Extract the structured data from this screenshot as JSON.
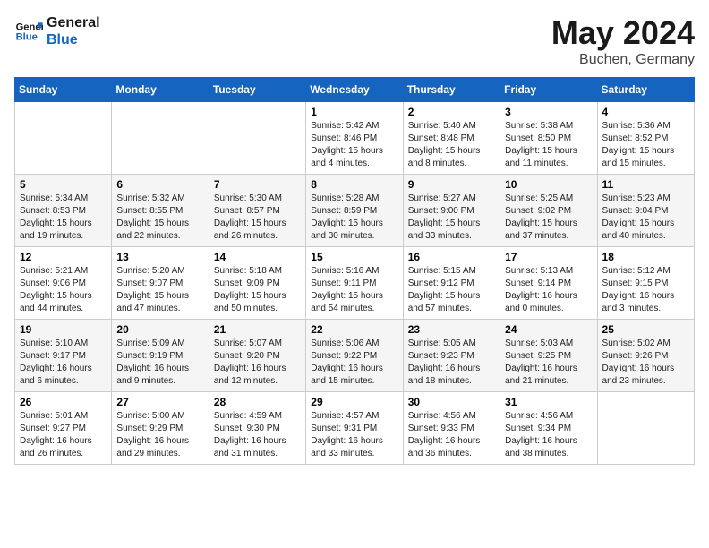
{
  "header": {
    "logo_line1": "General",
    "logo_line2": "Blue",
    "month_title": "May 2024",
    "location": "Buchen, Germany"
  },
  "weekdays": [
    "Sunday",
    "Monday",
    "Tuesday",
    "Wednesday",
    "Thursday",
    "Friday",
    "Saturday"
  ],
  "weeks": [
    [
      {
        "day": "",
        "info": ""
      },
      {
        "day": "",
        "info": ""
      },
      {
        "day": "",
        "info": ""
      },
      {
        "day": "1",
        "info": "Sunrise: 5:42 AM\nSunset: 8:46 PM\nDaylight: 15 hours\nand 4 minutes."
      },
      {
        "day": "2",
        "info": "Sunrise: 5:40 AM\nSunset: 8:48 PM\nDaylight: 15 hours\nand 8 minutes."
      },
      {
        "day": "3",
        "info": "Sunrise: 5:38 AM\nSunset: 8:50 PM\nDaylight: 15 hours\nand 11 minutes."
      },
      {
        "day": "4",
        "info": "Sunrise: 5:36 AM\nSunset: 8:52 PM\nDaylight: 15 hours\nand 15 minutes."
      }
    ],
    [
      {
        "day": "5",
        "info": "Sunrise: 5:34 AM\nSunset: 8:53 PM\nDaylight: 15 hours\nand 19 minutes."
      },
      {
        "day": "6",
        "info": "Sunrise: 5:32 AM\nSunset: 8:55 PM\nDaylight: 15 hours\nand 22 minutes."
      },
      {
        "day": "7",
        "info": "Sunrise: 5:30 AM\nSunset: 8:57 PM\nDaylight: 15 hours\nand 26 minutes."
      },
      {
        "day": "8",
        "info": "Sunrise: 5:28 AM\nSunset: 8:59 PM\nDaylight: 15 hours\nand 30 minutes."
      },
      {
        "day": "9",
        "info": "Sunrise: 5:27 AM\nSunset: 9:00 PM\nDaylight: 15 hours\nand 33 minutes."
      },
      {
        "day": "10",
        "info": "Sunrise: 5:25 AM\nSunset: 9:02 PM\nDaylight: 15 hours\nand 37 minutes."
      },
      {
        "day": "11",
        "info": "Sunrise: 5:23 AM\nSunset: 9:04 PM\nDaylight: 15 hours\nand 40 minutes."
      }
    ],
    [
      {
        "day": "12",
        "info": "Sunrise: 5:21 AM\nSunset: 9:06 PM\nDaylight: 15 hours\nand 44 minutes."
      },
      {
        "day": "13",
        "info": "Sunrise: 5:20 AM\nSunset: 9:07 PM\nDaylight: 15 hours\nand 47 minutes."
      },
      {
        "day": "14",
        "info": "Sunrise: 5:18 AM\nSunset: 9:09 PM\nDaylight: 15 hours\nand 50 minutes."
      },
      {
        "day": "15",
        "info": "Sunrise: 5:16 AM\nSunset: 9:11 PM\nDaylight: 15 hours\nand 54 minutes."
      },
      {
        "day": "16",
        "info": "Sunrise: 5:15 AM\nSunset: 9:12 PM\nDaylight: 15 hours\nand 57 minutes."
      },
      {
        "day": "17",
        "info": "Sunrise: 5:13 AM\nSunset: 9:14 PM\nDaylight: 16 hours\nand 0 minutes."
      },
      {
        "day": "18",
        "info": "Sunrise: 5:12 AM\nSunset: 9:15 PM\nDaylight: 16 hours\nand 3 minutes."
      }
    ],
    [
      {
        "day": "19",
        "info": "Sunrise: 5:10 AM\nSunset: 9:17 PM\nDaylight: 16 hours\nand 6 minutes."
      },
      {
        "day": "20",
        "info": "Sunrise: 5:09 AM\nSunset: 9:19 PM\nDaylight: 16 hours\nand 9 minutes."
      },
      {
        "day": "21",
        "info": "Sunrise: 5:07 AM\nSunset: 9:20 PM\nDaylight: 16 hours\nand 12 minutes."
      },
      {
        "day": "22",
        "info": "Sunrise: 5:06 AM\nSunset: 9:22 PM\nDaylight: 16 hours\nand 15 minutes."
      },
      {
        "day": "23",
        "info": "Sunrise: 5:05 AM\nSunset: 9:23 PM\nDaylight: 16 hours\nand 18 minutes."
      },
      {
        "day": "24",
        "info": "Sunrise: 5:03 AM\nSunset: 9:25 PM\nDaylight: 16 hours\nand 21 minutes."
      },
      {
        "day": "25",
        "info": "Sunrise: 5:02 AM\nSunset: 9:26 PM\nDaylight: 16 hours\nand 23 minutes."
      }
    ],
    [
      {
        "day": "26",
        "info": "Sunrise: 5:01 AM\nSunset: 9:27 PM\nDaylight: 16 hours\nand 26 minutes."
      },
      {
        "day": "27",
        "info": "Sunrise: 5:00 AM\nSunset: 9:29 PM\nDaylight: 16 hours\nand 29 minutes."
      },
      {
        "day": "28",
        "info": "Sunrise: 4:59 AM\nSunset: 9:30 PM\nDaylight: 16 hours\nand 31 minutes."
      },
      {
        "day": "29",
        "info": "Sunrise: 4:57 AM\nSunset: 9:31 PM\nDaylight: 16 hours\nand 33 minutes."
      },
      {
        "day": "30",
        "info": "Sunrise: 4:56 AM\nSunset: 9:33 PM\nDaylight: 16 hours\nand 36 minutes."
      },
      {
        "day": "31",
        "info": "Sunrise: 4:56 AM\nSunset: 9:34 PM\nDaylight: 16 hours\nand 38 minutes."
      },
      {
        "day": "",
        "info": ""
      }
    ]
  ]
}
